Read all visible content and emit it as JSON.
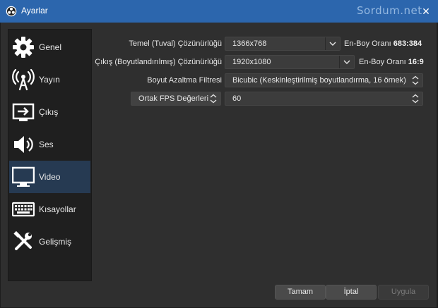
{
  "window": {
    "title": "Ayarlar",
    "watermark": "Sordum.net",
    "close_glyph": "✕"
  },
  "sidebar": {
    "items": [
      {
        "label": "Genel",
        "icon": "gear-icon"
      },
      {
        "label": "Yayın",
        "icon": "broadcast-antenna-icon"
      },
      {
        "label": "Çıkış",
        "icon": "output-screen-icon"
      },
      {
        "label": "Ses",
        "icon": "speaker-icon"
      },
      {
        "label": "Video",
        "icon": "monitor-icon",
        "active": true
      },
      {
        "label": "Kısayollar",
        "icon": "keyboard-icon"
      },
      {
        "label": "Gelişmiş",
        "icon": "tools-icon"
      }
    ]
  },
  "video": {
    "base_resolution": {
      "label": "Temel (Tuval) Çözünürlüğü",
      "value": "1366x768",
      "ratio_label": "En-Boy Oranı",
      "ratio_value": "683:384"
    },
    "output_resolution": {
      "label": "Çıkış (Boyutlandırılmış) Çözünürlüğü",
      "value": "1920x1080",
      "ratio_label": "En-Boy Oranı",
      "ratio_value": "16:9"
    },
    "downscale_filter": {
      "label": "Boyut Azaltma Filtresi",
      "value": "Bicubic (Keskinleştirilmiş boyutlandırma, 16 örnek)"
    },
    "fps": {
      "label": "Ortak FPS Değerleri",
      "value": "60"
    }
  },
  "buttons": {
    "ok": "Tamam",
    "cancel": "İptal",
    "apply": "Uygula"
  },
  "colors": {
    "titlebar": "#2c66ad",
    "active_item": "#263a52"
  }
}
